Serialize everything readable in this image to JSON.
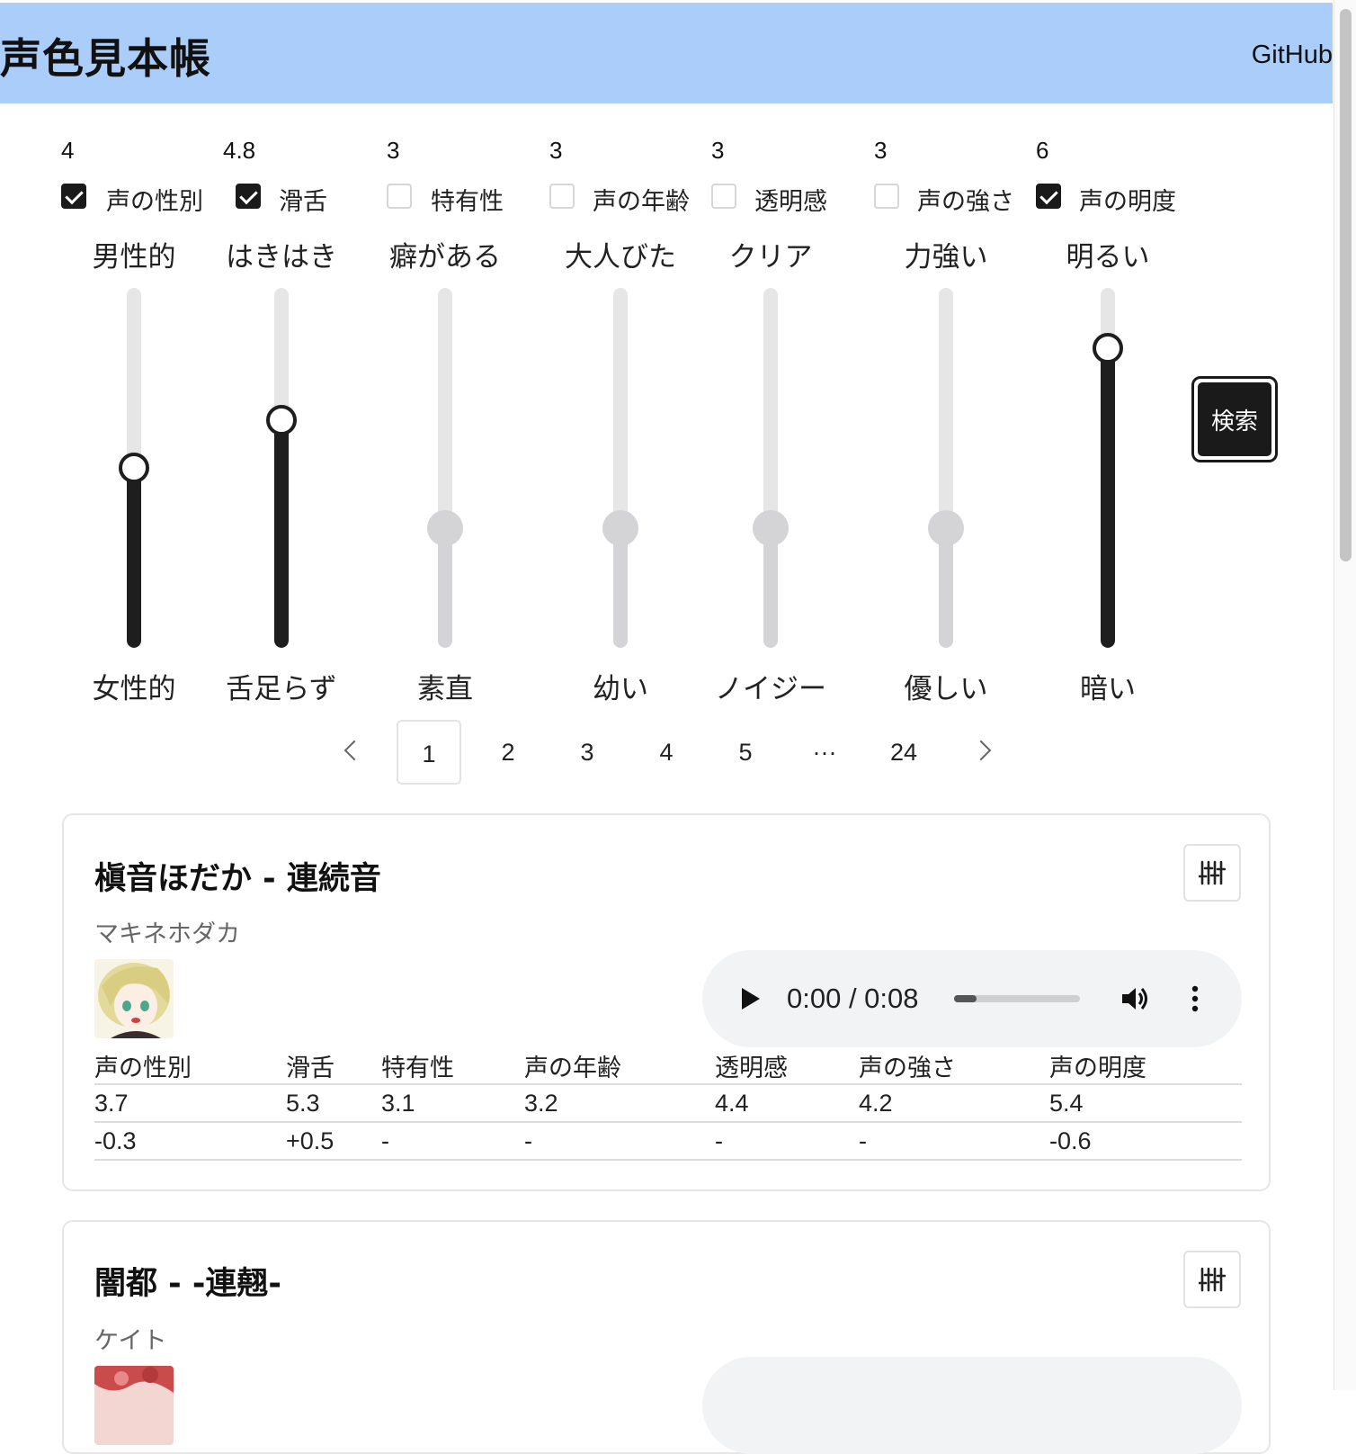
{
  "header": {
    "title": "声色見本帳",
    "github_label": "GitHub",
    "background": "#abcdf9"
  },
  "sliders": [
    {
      "value": "4",
      "checkbox_label": "声の性別",
      "checked": true,
      "top_label": "男性的",
      "bottom_label": "女性的",
      "level": 4,
      "min": 1,
      "max": 7
    },
    {
      "value": "4.8",
      "checkbox_label": "滑舌",
      "checked": true,
      "top_label": "はきはき",
      "bottom_label": "舌足らず",
      "level": 4.8,
      "min": 1,
      "max": 7
    },
    {
      "value": "3",
      "checkbox_label": "特有性",
      "checked": false,
      "top_label": "癖がある",
      "bottom_label": "素直",
      "level": 3,
      "min": 1,
      "max": 7
    },
    {
      "value": "3",
      "checkbox_label": "声の年齢",
      "checked": false,
      "top_label": "大人びた",
      "bottom_label": "幼い",
      "level": 3,
      "min": 1,
      "max": 7
    },
    {
      "value": "3",
      "checkbox_label": "透明感",
      "checked": false,
      "top_label": "クリア",
      "bottom_label": "ノイジー",
      "level": 3,
      "min": 1,
      "max": 7
    },
    {
      "value": "3",
      "checkbox_label": "声の強さ",
      "checked": false,
      "top_label": "力強い",
      "bottom_label": "優しい",
      "level": 3,
      "min": 1,
      "max": 7
    },
    {
      "value": "6",
      "checkbox_label": "声の明度",
      "checked": true,
      "top_label": "明るい",
      "bottom_label": "暗い",
      "level": 6,
      "min": 1,
      "max": 7
    }
  ],
  "search_button": {
    "label": "検索"
  },
  "pagination": {
    "pages": [
      "1",
      "2",
      "3",
      "4",
      "5",
      "···",
      "24"
    ],
    "current": "1"
  },
  "results": [
    {
      "title": "槇音ほだか - 連続音",
      "subtitle": "マキネホダカ",
      "audio": {
        "time": "0:00 / 0:08",
        "progress": 0.18
      },
      "stat_headers": [
        "声の性別",
        "滑舌",
        "特有性",
        "声の年齢",
        "透明感",
        "声の強さ",
        "声の明度"
      ],
      "stat_values": [
        "3.7",
        "5.3",
        "3.1",
        "3.2",
        "4.4",
        "4.2",
        "5.4"
      ],
      "stat_diffs": [
        "-0.3",
        "+0.5",
        "-",
        "-",
        "-",
        "-",
        "-0.6"
      ]
    },
    {
      "title": "闇都 - -連翹-",
      "subtitle": "ケイト"
    }
  ],
  "colors": {
    "accent": "#1e1e1e",
    "disabled": "#d4d4d7",
    "track": "#e6e6e6",
    "card_border": "#e6e6e6",
    "player_bg": "#f1f3f4"
  }
}
